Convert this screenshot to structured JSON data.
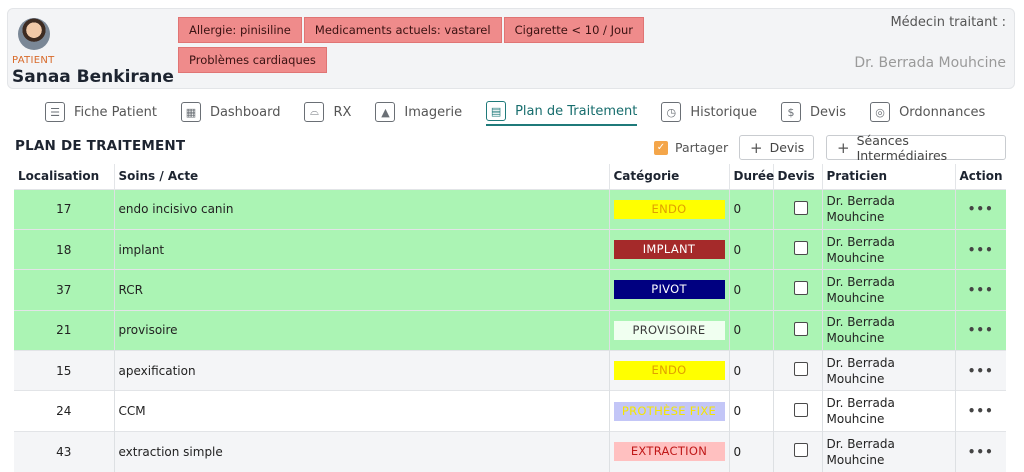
{
  "patient": {
    "tag": "PATIENT",
    "name": "Sanaa Benkirane",
    "badges": [
      "Allergie: pinisiline",
      "Medicaments actuels: vastarel",
      "Cigarette < 10 / Jour",
      "Problèmes cardiaques"
    ],
    "doctor_label": "Médecin traitant :",
    "doctor_name": "Dr. Berrada Mouhcine",
    "badge_color": "#ef8b8b"
  },
  "tabs": [
    {
      "label": "Fiche Patient",
      "icon": "patient-file-icon",
      "active": false
    },
    {
      "label": "Dashboard",
      "icon": "dashboard-icon",
      "active": false
    },
    {
      "label": "RX",
      "icon": "tooth-icon",
      "active": false
    },
    {
      "label": "Imagerie",
      "icon": "image-icon",
      "active": false
    },
    {
      "label": "Plan de Traitement",
      "icon": "calendar-icon",
      "active": true
    },
    {
      "label": "Historique",
      "icon": "history-icon",
      "active": false
    },
    {
      "label": "Devis",
      "icon": "money-icon",
      "active": false
    },
    {
      "label": "Ordonnances",
      "icon": "prescription-icon",
      "active": false
    }
  ],
  "section": {
    "title": "PLAN DE TRAITEMENT",
    "share_label": "Partager",
    "devis_button": "Devis",
    "seances_button": "Séances Intermédiaires",
    "accent": "#f4a64a"
  },
  "table": {
    "headers": [
      "Localisation",
      "Soins / Acte",
      "Catégorie",
      "Durée",
      "Devis",
      "Praticien",
      "Action"
    ],
    "rows": [
      {
        "loc": "17",
        "acte": "endo incisivo canin",
        "cat": "ENDO",
        "cat_bg": "#ffff00",
        "cat_fg": "#e0a000",
        "duree": "0",
        "praticien": "Dr. Berrada Mouhcine",
        "style": "planned"
      },
      {
        "loc": "18",
        "acte": "implant",
        "cat": "IMPLANT",
        "cat_bg": "#a52a2a",
        "cat_fg": "#ffffff",
        "duree": "0",
        "praticien": "Dr. Berrada Mouhcine",
        "style": "planned"
      },
      {
        "loc": "37",
        "acte": "RCR",
        "cat": "PIVOT",
        "cat_bg": "#000080",
        "cat_fg": "#ffffff",
        "duree": "0",
        "praticien": "Dr. Berrada Mouhcine",
        "style": "planned"
      },
      {
        "loc": "21",
        "acte": "provisoire",
        "cat": "PROVISOIRE",
        "cat_bg": "#f0fff0",
        "cat_fg": "#3a3a3a",
        "duree": "0",
        "praticien": "Dr. Berrada Mouhcine",
        "style": "planned"
      },
      {
        "loc": "15",
        "acte": "apexification",
        "cat": "ENDO",
        "cat_bg": "#ffff00",
        "cat_fg": "#e0a000",
        "duree": "0",
        "praticien": "Dr. Berrada Mouhcine",
        "style": "alt"
      },
      {
        "loc": "24",
        "acte": "CCM",
        "cat": "PROTHÈSE FIXE",
        "cat_bg": "#c3c6f7",
        "cat_fg": "#f5e600",
        "duree": "0",
        "praticien": "Dr. Berrada Mouhcine",
        "style": "plain"
      },
      {
        "loc": "43",
        "acte": "extraction simple",
        "cat": "EXTRACTION",
        "cat_bg": "#ffc0c0",
        "cat_fg": "#c01818",
        "duree": "0",
        "praticien": "Dr. Berrada Mouhcine",
        "style": "alt"
      }
    ],
    "action_label": "•••",
    "planned_color": "#abf4b4"
  }
}
